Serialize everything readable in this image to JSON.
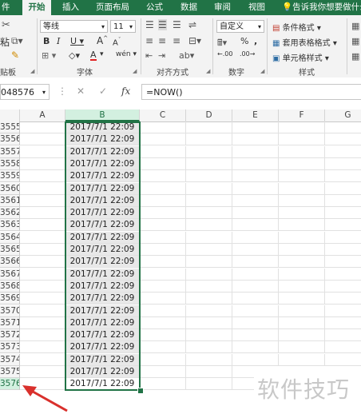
{
  "ribbon_tabs": [
    "件",
    "开始",
    "插入",
    "页面布局",
    "公式",
    "数据",
    "审阅",
    "视图"
  ],
  "tell_me": "告诉我你想要做什么",
  "clipboard": {
    "paste_label": "粘",
    "group_label": "贴板"
  },
  "font": {
    "name": "等线",
    "size": "11",
    "bold": "B",
    "italic": "I",
    "underline": "U",
    "grow": "A",
    "shrink": "A",
    "color_a": "A",
    "phonetic": "wén",
    "group_label": "字体"
  },
  "alignment": {
    "group_label": "对齐方式"
  },
  "number": {
    "format": "自定义",
    "percent": "%",
    "comma": ",",
    "dec_inc": ".00",
    "dec_dec": ".00",
    "group_label": "数字"
  },
  "styles": {
    "conditional": "条件格式",
    "table": "套用表格格式",
    "cell": "单元格样式",
    "group_label": "样式"
  },
  "name_box": "048576",
  "formula_bar": {
    "cancel": "✕",
    "enter": "✓",
    "fx": "fx",
    "content": "=NOW()"
  },
  "columns": [
    "A",
    "B",
    "C",
    "D",
    "E",
    "F",
    "G"
  ],
  "rows": [
    {
      "num": "3555",
      "b": "2017/7/1 22:09"
    },
    {
      "num": "3556",
      "b": "2017/7/1 22:09"
    },
    {
      "num": "3557",
      "b": "2017/7/1 22:09"
    },
    {
      "num": "3558",
      "b": "2017/7/1 22:09"
    },
    {
      "num": "3559",
      "b": "2017/7/1 22:09"
    },
    {
      "num": "3560",
      "b": "2017/7/1 22:09"
    },
    {
      "num": "3561",
      "b": "2017/7/1 22:09"
    },
    {
      "num": "3562",
      "b": "2017/7/1 22:09"
    },
    {
      "num": "3563",
      "b": "2017/7/1 22:09"
    },
    {
      "num": "3564",
      "b": "2017/7/1 22:09"
    },
    {
      "num": "3565",
      "b": "2017/7/1 22:09"
    },
    {
      "num": "3566",
      "b": "2017/7/1 22:09"
    },
    {
      "num": "3567",
      "b": "2017/7/1 22:09"
    },
    {
      "num": "3568",
      "b": "2017/7/1 22:09"
    },
    {
      "num": "3569",
      "b": "2017/7/1 22:09"
    },
    {
      "num": "3570",
      "b": "2017/7/1 22:09"
    },
    {
      "num": "3571",
      "b": "2017/7/1 22:09"
    },
    {
      "num": "3572",
      "b": "2017/7/1 22:09"
    },
    {
      "num": "3573",
      "b": "2017/7/1 22:09"
    },
    {
      "num": "3574",
      "b": "2017/7/1 22:09"
    },
    {
      "num": "3575",
      "b": "2017/7/1 22:09"
    },
    {
      "num": "3576",
      "b": "2017/7/1 22:09"
    }
  ],
  "watermark": "软件技巧",
  "colors": {
    "excel_green": "#217346",
    "arrow_red": "#d9302c"
  }
}
